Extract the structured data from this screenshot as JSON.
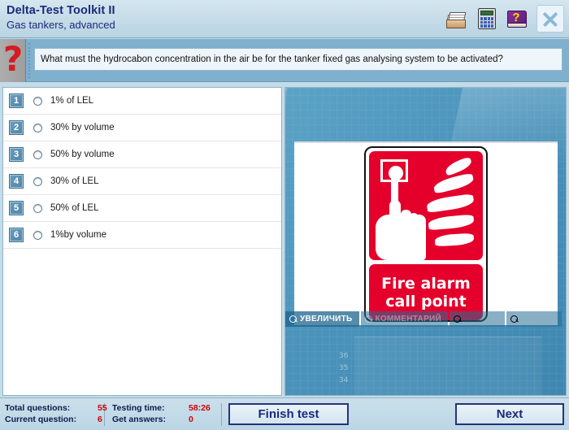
{
  "header": {
    "app_title": "Delta-Test Toolkit II",
    "subtitle": "Gas tankers, advanced",
    "icons": {
      "cardfile": "cardfile-icon",
      "calculator": "calculator-icon",
      "help_book": "help-book-icon",
      "help_glyph": "?",
      "close": "close-icon"
    }
  },
  "question": {
    "marker": "?",
    "text": "What must the hydrocabon concentration in the air be for the tanker fixed gas analysing system to be activated?"
  },
  "answers": [
    {
      "num": "1",
      "label": "1% of LEL"
    },
    {
      "num": "2",
      "label": "30% by volume"
    },
    {
      "num": "3",
      "label": "50% by volume"
    },
    {
      "num": "4",
      "label": "30% of LEL"
    },
    {
      "num": "5",
      "label": "50% of LEL"
    },
    {
      "num": "6",
      "label": "1%by volume"
    }
  ],
  "image_panel": {
    "sign": {
      "line1": "Fire alarm",
      "line2": "call point",
      "red": "#e4002b"
    },
    "backdrop_numbers": "36\n35\n34",
    "toolbar": {
      "zoom_label": "УВЕЛИЧИТЬ",
      "comment_label": "КОММЕНТАРИЙ"
    }
  },
  "status": {
    "total_questions_label": "Total questions:",
    "total_questions_value": "55",
    "current_question_label": "Current question:",
    "current_question_value": "6",
    "testing_time_label": "Testing time:",
    "testing_time_value": "58:26",
    "get_answers_label": "Get answers:",
    "get_answers_value": "0",
    "finish_test_label": "Finish test",
    "next_label": "Next"
  }
}
